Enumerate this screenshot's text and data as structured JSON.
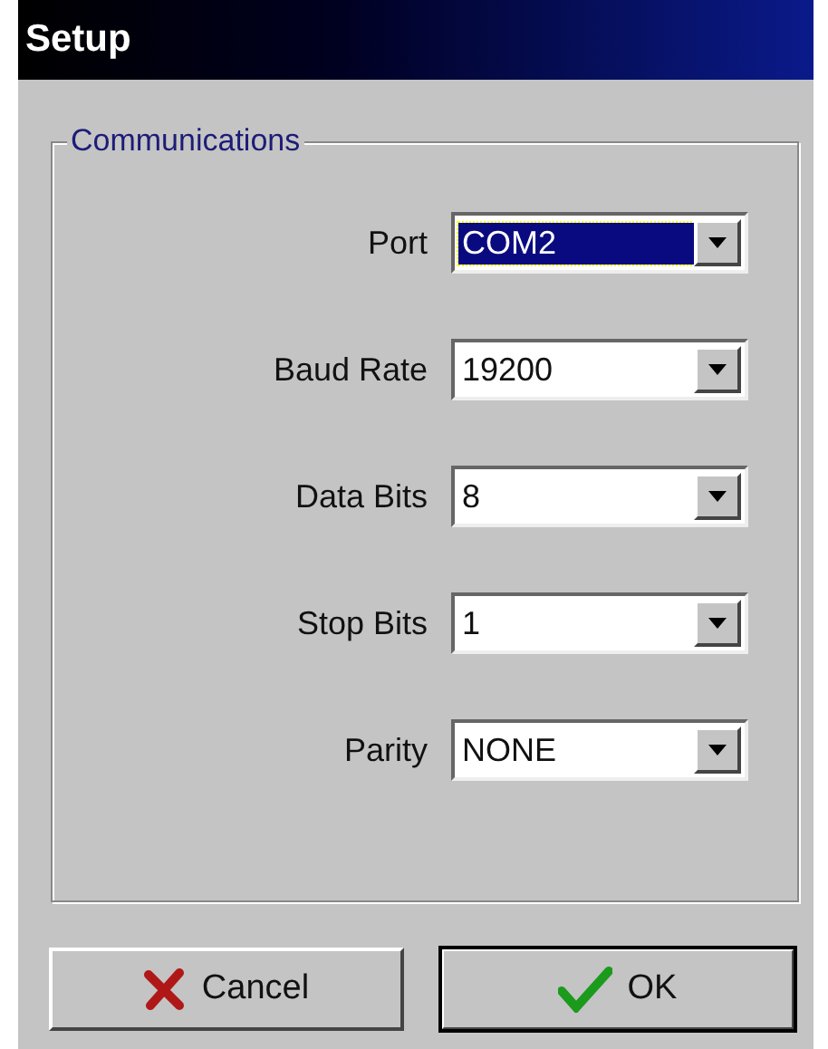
{
  "window": {
    "title": "Setup"
  },
  "group": {
    "title": "Communications",
    "fields": [
      {
        "label": "Port",
        "value": "COM2",
        "focused": true
      },
      {
        "label": "Baud Rate",
        "value": "19200",
        "focused": false
      },
      {
        "label": "Data Bits",
        "value": "8",
        "focused": false
      },
      {
        "label": "Stop Bits",
        "value": "1",
        "focused": false
      },
      {
        "label": "Parity",
        "value": "NONE",
        "focused": false
      }
    ]
  },
  "buttons": [
    {
      "label": "Cancel",
      "kind": "cancel",
      "default": false
    },
    {
      "label": "OK",
      "kind": "ok",
      "default": true
    }
  ]
}
